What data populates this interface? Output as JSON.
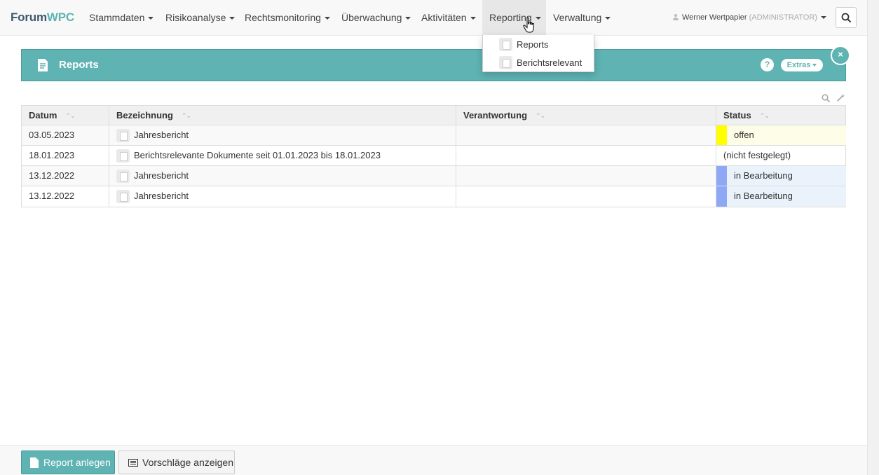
{
  "brand": {
    "part1": "Forum",
    "part2": "WPC"
  },
  "nav": {
    "items": [
      {
        "label": "Stammdaten"
      },
      {
        "label": "Risikoanalyse"
      },
      {
        "label": "Rechtsmonitoring"
      },
      {
        "label": "Überwachung"
      },
      {
        "label": "Aktivitäten"
      },
      {
        "label": "Reporting",
        "active": true
      },
      {
        "label": "Verwaltung"
      }
    ],
    "user": {
      "name": "Werner Wertpapier",
      "role": "(ADMINISTRATOR)"
    },
    "search_icon": "search-icon"
  },
  "dropdown": {
    "items": [
      {
        "label": "Reports",
        "icon": "document-icon"
      },
      {
        "label": "Berichtsrelevant",
        "icon": "document-icon"
      }
    ]
  },
  "panel": {
    "title": "Reports",
    "help_label": "?",
    "extras_label": "Extras",
    "close_label": "×",
    "color": "#5fb3b3"
  },
  "table": {
    "columns": [
      "Datum",
      "Bezeichnung",
      "Verantwortung",
      "Status"
    ],
    "rows": [
      {
        "datum": "03.05.2023",
        "bezeichnung": "Jahresbericht",
        "verantwortung": "",
        "status": "offen",
        "status_color": "#ffff00"
      },
      {
        "datum": "18.01.2023",
        "bezeichnung": "Berichtsrelevante Dokumente seit 01.01.2023 bis 18.01.2023",
        "verantwortung": "",
        "status": "(nicht festgelegt)",
        "status_color": ""
      },
      {
        "datum": "13.12.2022",
        "bezeichnung": "Jahresbericht",
        "verantwortung": "",
        "status": "in Bearbeitung",
        "status_color": "#8fa8f5"
      },
      {
        "datum": "13.12.2022",
        "bezeichnung": "Jahresbericht",
        "verantwortung": "",
        "status": "in Bearbeitung",
        "status_color": "#8fa8f5"
      }
    ]
  },
  "footer": {
    "primary_label": "Report anlegen",
    "secondary_label": "Vorschläge anzeigen"
  }
}
